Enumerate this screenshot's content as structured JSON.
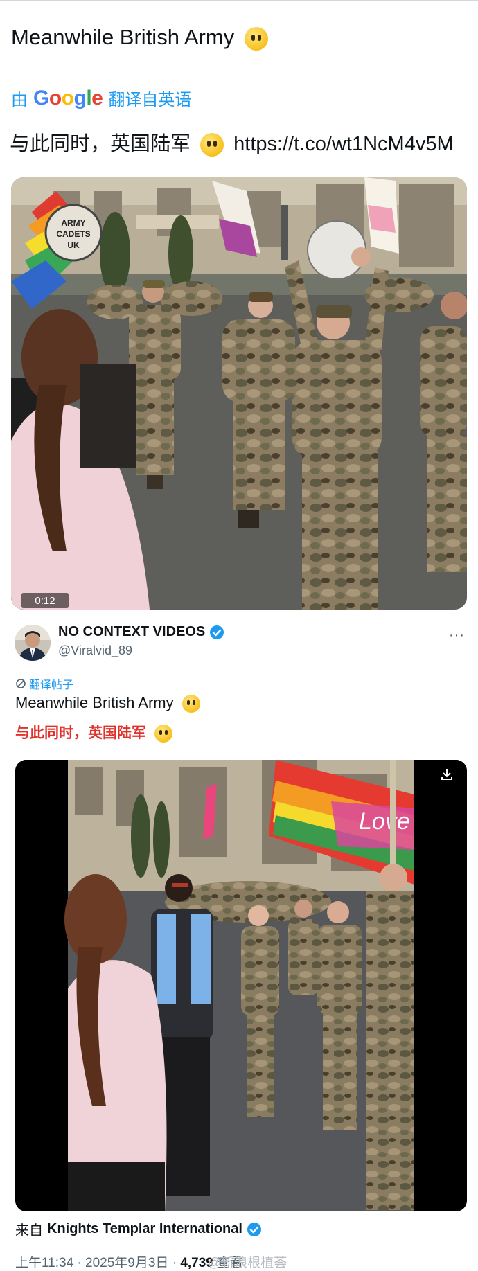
{
  "post": {
    "text": "Meanwhile British Army",
    "translate_prefix": "由",
    "translate_brand": "Google",
    "translate_suffix": "翻译自英语",
    "translated_text": "与此同时，英国陆军",
    "link": "https://t.co/wt1NcM4v5M",
    "sign_text": "ARMY CADETS UK",
    "video_time": "0:12"
  },
  "quoted": {
    "name": "NO CONTEXT VIDEOS",
    "handle": "@Viralvid_89",
    "more_label": "···",
    "translate_label": "翻译帖子",
    "text_en": "Meanwhile British Army",
    "text_cn": "与此同时，英国陆军",
    "flag_text": "Love"
  },
  "footer": {
    "from_prefix": "来自",
    "from_name": "Knights Templar International",
    "timestamp": "上午11:34 · 2025年9月3日 · ",
    "views": "4,739",
    "views_label": " 查看",
    "watermark": "@新浪根植荟"
  },
  "colors": {
    "accent": "#1d9bf0",
    "translation_red": "#e0322b",
    "text": "#0f1419",
    "muted": "#536471"
  },
  "icons": [
    "emoji-face-icon",
    "google-logo-icon",
    "verified-badge-icon",
    "translate-icon",
    "download-icon",
    "more-icon"
  ]
}
